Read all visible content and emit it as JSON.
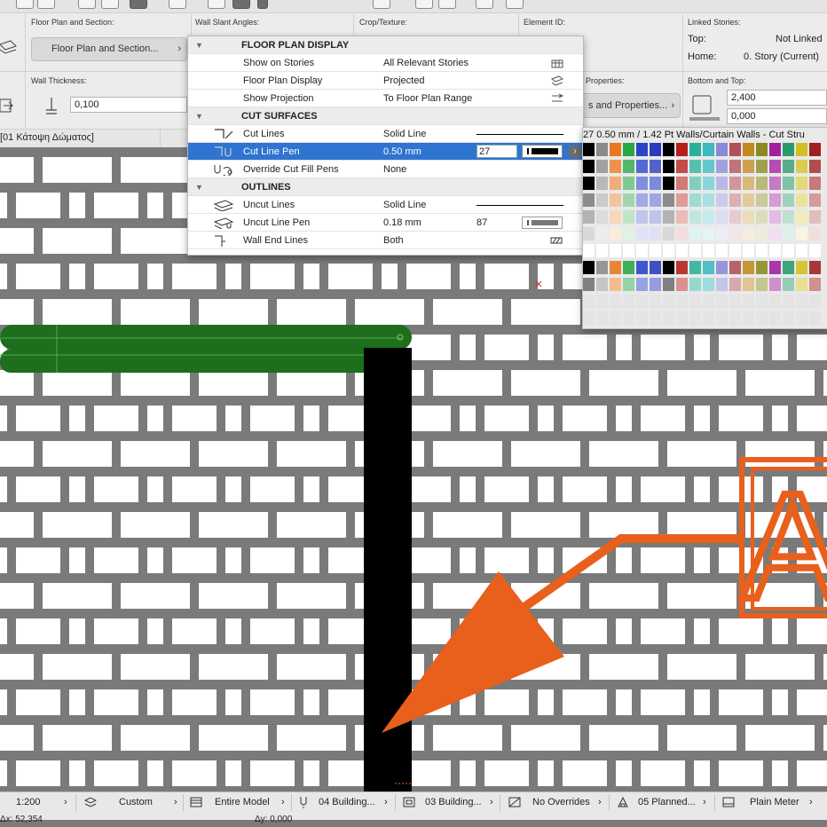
{
  "info_box": {
    "floor_plan_section_label": "Floor Plan and Section:",
    "floor_plan_section_button": "Floor Plan and Section...",
    "wall_slant_label": "Wall Slant Angles:",
    "crop_texture_label": "Crop/Texture:",
    "element_id_label": "Element ID:",
    "linked_stories_label": "Linked Stories:",
    "top_label": "Top:",
    "top_value": "Not Linked",
    "home_label": "Home:",
    "home_value": "0. Story (Current)",
    "wall_thickness_label": "Wall Thickness:",
    "wall_thickness_value": "0,100",
    "properties_label": "Properties:",
    "properties_button": "s and Properties...",
    "bottom_top_label": "Bottom and Top:",
    "top_height": "2,400",
    "bottom_offset": "0,000",
    "story_tab": "[01 Κάτοψη Δώματος]"
  },
  "panel": {
    "sections": [
      {
        "title": "FLOOR PLAN DISPLAY",
        "rows": [
          {
            "name": "Show on Stories",
            "value": "All Relevant Stories",
            "right_icon": "stories-icon"
          },
          {
            "name": "Floor Plan Display",
            "value": "Projected",
            "right_icon": "projected-icon"
          },
          {
            "name": "Show Projection",
            "value": "To Floor Plan Range",
            "right_icon": "range-icon"
          }
        ]
      },
      {
        "title": "CUT SURFACES",
        "rows": [
          {
            "name": "Cut Lines",
            "value": "Solid Line",
            "icon": "cut-lines-icon"
          },
          {
            "name": "Cut Line Pen",
            "value": "0.50 mm",
            "pen": "27",
            "icon": "cut-line-pen-icon",
            "selected": true
          },
          {
            "name": "Override Cut Fill Pens",
            "value": "None",
            "icon": "override-fill-icon"
          }
        ]
      },
      {
        "title": "OUTLINES",
        "rows": [
          {
            "name": "Uncut Lines",
            "value": "Solid Line",
            "icon": "uncut-lines-icon"
          },
          {
            "name": "Uncut Line Pen",
            "value": "0.18 mm",
            "pen": "87",
            "icon": "uncut-line-pen-icon"
          },
          {
            "name": "Wall End Lines",
            "value": "Both",
            "icon": "wall-end-icon"
          }
        ]
      }
    ]
  },
  "palette": {
    "title": "27  0.50 mm /  1.42 Pt Walls/Curtain Walls - Cut Stru"
  },
  "status_bar": {
    "scale": "1:200",
    "layer_combo": "Custom",
    "model_view": "Entire Model",
    "pen_set": "04 Building...",
    "mvo": "03 Building...",
    "overrides": "No Overrides",
    "renovation": "05 Planned...",
    "dimension": "Plain Meter",
    "coord_x": "Δx: 52,354",
    "coord_y": "Δy: 0,000"
  },
  "canvas": {
    "marker_letter": "A"
  },
  "colors": {
    "selection_blue": "#2f74d0",
    "wall_green": "#1d6e1d",
    "arrow_orange": "#e8601c",
    "hatch_gray": "#7a7a7a"
  }
}
